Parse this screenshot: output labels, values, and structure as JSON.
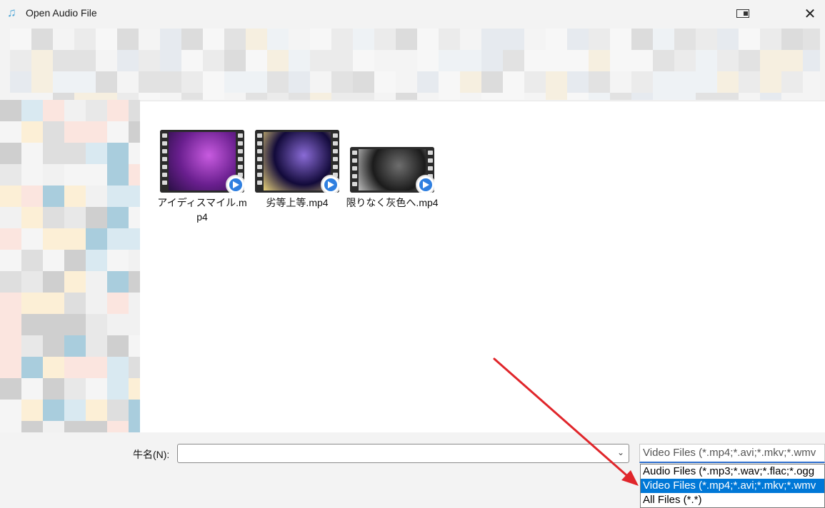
{
  "window": {
    "title": "Open Audio File",
    "app_icon": "music-note-icon",
    "restore_icon": "restore-icon",
    "close_icon": "close-icon"
  },
  "files": [
    {
      "name": "アイディスマイル.mp4",
      "thumb_colors": [
        "#6a1f8f",
        "#c85be0",
        "#2a0f45"
      ]
    },
    {
      "name": "劣等上等.mp4",
      "thumb_colors": [
        "#120a3a",
        "#8a6bd6",
        "#e9d37a"
      ]
    },
    {
      "name": "限りなく灰色へ.mp4",
      "thumb_colors": [
        "#1b1b1b",
        "#6e6e6e",
        "#bdbdbd"
      ]
    }
  ],
  "filename": {
    "label": "牛名(N):",
    "value": ""
  },
  "filetype": {
    "selected": "Video Files (*.mp4;*.avi;*.mkv;*.wmv",
    "options": [
      "Audio Files (*.mp3;*.wav;*.flac;*.ogg",
      "Video Files (*.mp4;*.avi;*.mkv;*.wmv",
      "All Files (*.*)"
    ],
    "selected_index": 1
  },
  "colors": {
    "accent": "#0078d7",
    "annotation_arrow": "#e0262b"
  }
}
